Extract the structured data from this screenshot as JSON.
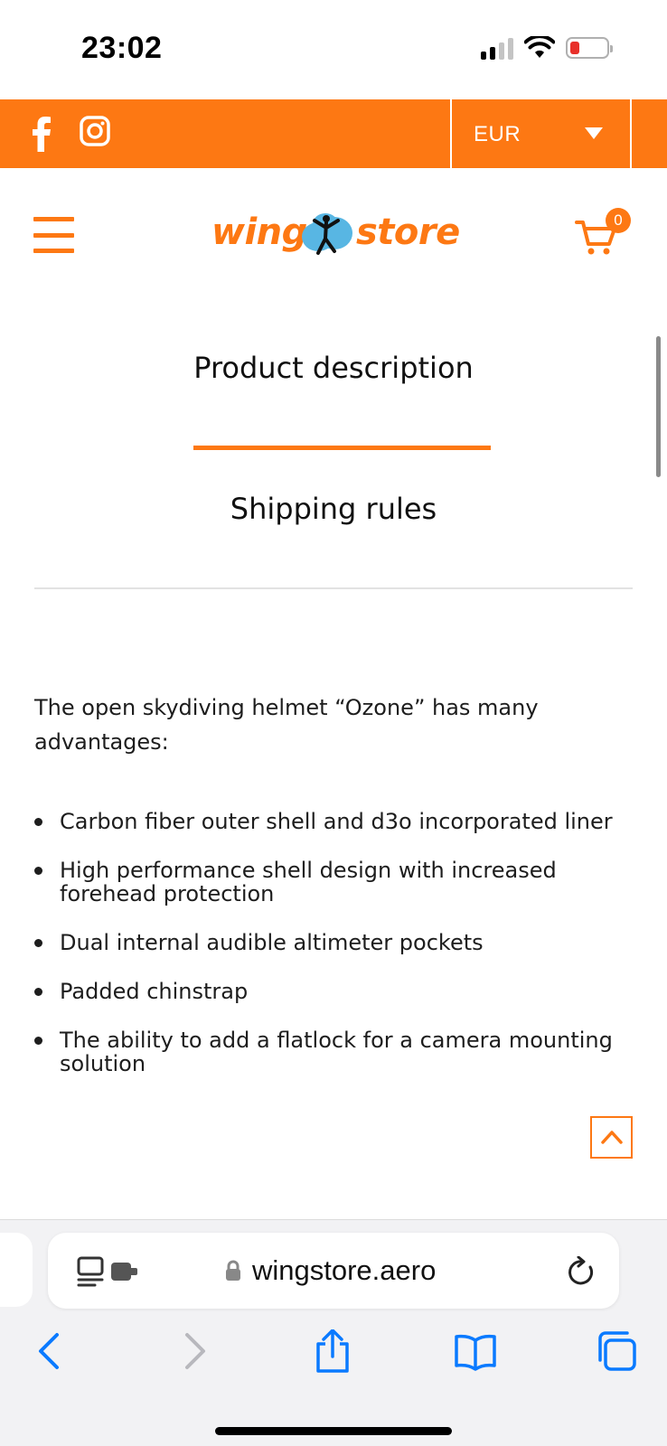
{
  "status_bar": {
    "time": "23:02",
    "icons": [
      "cellular-signal-icon",
      "wifi-icon",
      "battery-low-icon"
    ]
  },
  "top_bar": {
    "social": [
      "facebook-icon",
      "instagram-icon"
    ],
    "currency": "EUR"
  },
  "header": {
    "logo_left": "wing",
    "logo_right": "store",
    "cart_count": "0",
    "icons": [
      "menu-icon",
      "skydiver-logo-icon",
      "cart-icon"
    ]
  },
  "tabs": {
    "active": "Product description",
    "shipping": "Shipping rules"
  },
  "description": {
    "intro": "The open skydiving helmet “Ozone” has many advantages:",
    "features": [
      "Carbon fiber outer shell and d3o incorporated liner",
      "High performance shell design with increased forehead protection",
      "Dual internal audible altimeter pockets",
      "Padded chinstrap",
      "The ability to add a flatlock for a camera mounting solution"
    ]
  },
  "browser": {
    "url": "wingstore.aero",
    "toolbar_icons": [
      "back-icon",
      "forward-icon",
      "share-icon",
      "bookmarks-icon",
      "tabs-icon"
    ]
  },
  "colors": {
    "brand_orange": "#fd7813",
    "ios_blue": "#0a7aff"
  }
}
